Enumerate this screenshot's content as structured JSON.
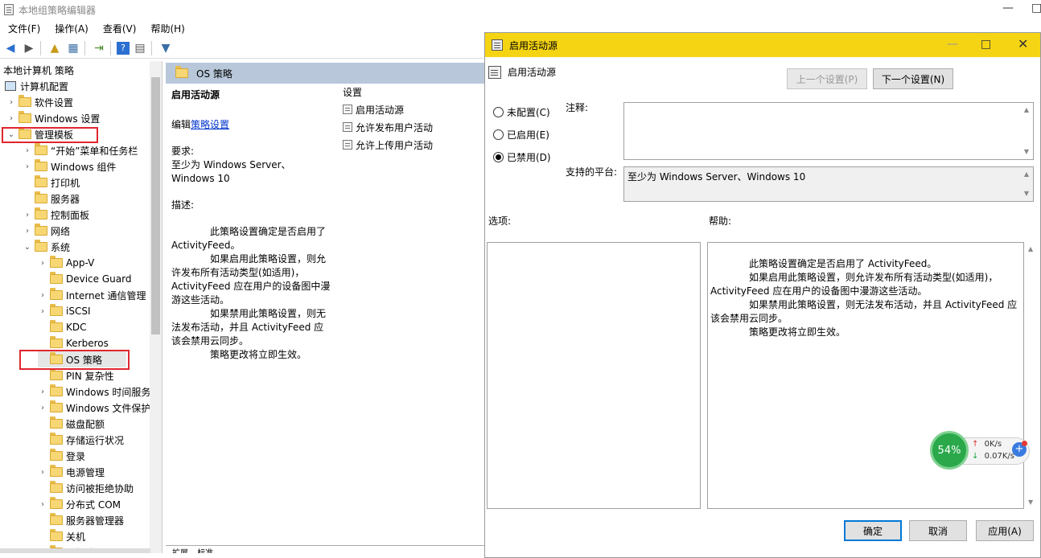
{
  "main_window": {
    "title": "本地组策略编辑器",
    "menu": [
      "文件(F)",
      "操作(A)",
      "查看(V)",
      "帮助(H)"
    ]
  },
  "tree": {
    "items": [
      {
        "label": "本地计算机 策略",
        "chevron": ""
      },
      {
        "label": "计算机配置",
        "chevron": ""
      },
      {
        "label": "软件设置",
        "chevron": "›"
      },
      {
        "label": "Windows 设置",
        "chevron": "›"
      },
      {
        "label": "管理模板",
        "chevron": "⌄"
      },
      {
        "label": "“开始”菜单和任务栏",
        "chevron": "›"
      },
      {
        "label": "Windows 组件",
        "chevron": "›"
      },
      {
        "label": "打印机",
        "chevron": ""
      },
      {
        "label": "服务器",
        "chevron": ""
      },
      {
        "label": "控制面板",
        "chevron": "›"
      },
      {
        "label": "网络",
        "chevron": "›"
      },
      {
        "label": "系统",
        "chevron": "⌄"
      },
      {
        "label": "App-V",
        "chevron": "›"
      },
      {
        "label": "Device Guard",
        "chevron": ""
      },
      {
        "label": "Internet 通信管理",
        "chevron": "›"
      },
      {
        "label": "iSCSI",
        "chevron": "›"
      },
      {
        "label": "KDC",
        "chevron": ""
      },
      {
        "label": "Kerberos",
        "chevron": ""
      },
      {
        "label": "OS 策略",
        "chevron": ""
      },
      {
        "label": "PIN 复杂性",
        "chevron": ""
      },
      {
        "label": "Windows 时间服务",
        "chevron": "›"
      },
      {
        "label": "Windows 文件保护",
        "chevron": "›"
      },
      {
        "label": "磁盘配额",
        "chevron": ""
      },
      {
        "label": "存储运行状况",
        "chevron": ""
      },
      {
        "label": "登录",
        "chevron": ""
      },
      {
        "label": "电源管理",
        "chevron": "›"
      },
      {
        "label": "访问被拒绝协助",
        "chevron": ""
      },
      {
        "label": "分布式 COM",
        "chevron": "›"
      },
      {
        "label": "服务器管理器",
        "chevron": ""
      },
      {
        "label": "关机",
        "chevron": ""
      },
      {
        "label": "关机选项",
        "chevron": ""
      }
    ]
  },
  "middle": {
    "header": "OS 策略",
    "policy_title": "启用活动源",
    "edit_prefix": "编辑",
    "edit_link": "策略设置",
    "requirements_label": "要求:",
    "requirements_text": "至少为 Windows Server、Windows 10",
    "description_label": "描述:",
    "description": [
      "此策略设置确定是否启用了 ActivityFeed。",
      "如果启用此策略设置，则允许发布所有活动类型(如适用)，ActivityFeed 应在用户的设备图中漫游这些活动。",
      "如果禁用此策略设置，则无法发布活动，并且 ActivityFeed 应该会禁用云同步。",
      "策略更改将立即生效。"
    ],
    "settings_header": "设置",
    "settings": [
      "启用活动源",
      "允许发布用户活动",
      "允许上传用户活动"
    ],
    "tabs": [
      "扩展",
      "标准"
    ]
  },
  "dialog": {
    "title": "启用活动源",
    "heading": "启用活动源",
    "prev_button": "上一个设置(P)",
    "next_button": "下一个设置(N)",
    "radio_not_configured": "未配置(C)",
    "radio_enabled": "已启用(E)",
    "radio_disabled": "已禁用(D)",
    "comment_label": "注释:",
    "comment_value": "",
    "platform_label": "支持的平台:",
    "platform_value": "至少为 Windows Server、Windows 10",
    "options_label": "选项:",
    "help_label": "帮助:",
    "help_text": [
      "此策略设置确定是否启用了 ActivityFeed。",
      "如果启用此策略设置，则允许发布所有活动类型(如适用)，ActivityFeed 应在用户的设备图中漫游这些活动。",
      "如果禁用此策略设置，则无法发布活动，并且 ActivityFeed 应该会禁用云同步。",
      "策略更改将立即生效。"
    ],
    "ok_button": "确定",
    "cancel_button": "取消",
    "apply_button": "应用(A)"
  },
  "net_widget": {
    "percent": "54%",
    "upload": "0K/s",
    "download": "0.07K/s"
  },
  "colors": {
    "dialog_title_bg": "#f5d414",
    "highlight_red": "#e0262f",
    "link": "#0033cc"
  }
}
